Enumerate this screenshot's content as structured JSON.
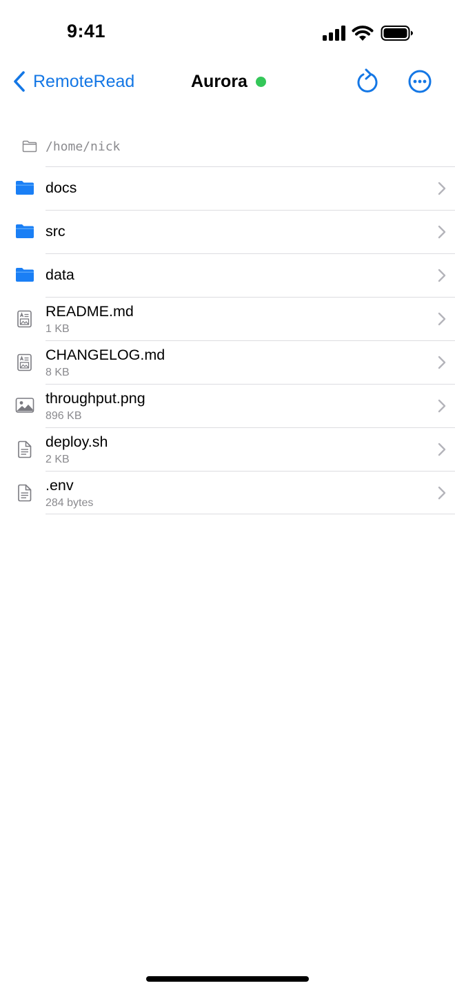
{
  "status_bar": {
    "time": "9:41"
  },
  "nav": {
    "back_label": "RemoteRead",
    "title": "Aurora",
    "connection_color": "#34c759",
    "accent": "#1477e5",
    "refresh_icon": "arrow-clockwise-icon",
    "more_icon": "ellipsis-circle-icon"
  },
  "path": "/home/nick",
  "files": [
    {
      "name": "docs",
      "kind": "folder"
    },
    {
      "name": "src",
      "kind": "folder"
    },
    {
      "name": "data",
      "kind": "folder"
    },
    {
      "name": "README.md",
      "size": "1 KB",
      "kind": "markdown"
    },
    {
      "name": "CHANGELOG.md",
      "size": "8 KB",
      "kind": "markdown"
    },
    {
      "name": "throughput.png",
      "size": "896 KB",
      "kind": "image"
    },
    {
      "name": "deploy.sh",
      "size": "2 KB",
      "kind": "text"
    },
    {
      "name": ".env",
      "size": "284 bytes",
      "kind": "text"
    }
  ]
}
